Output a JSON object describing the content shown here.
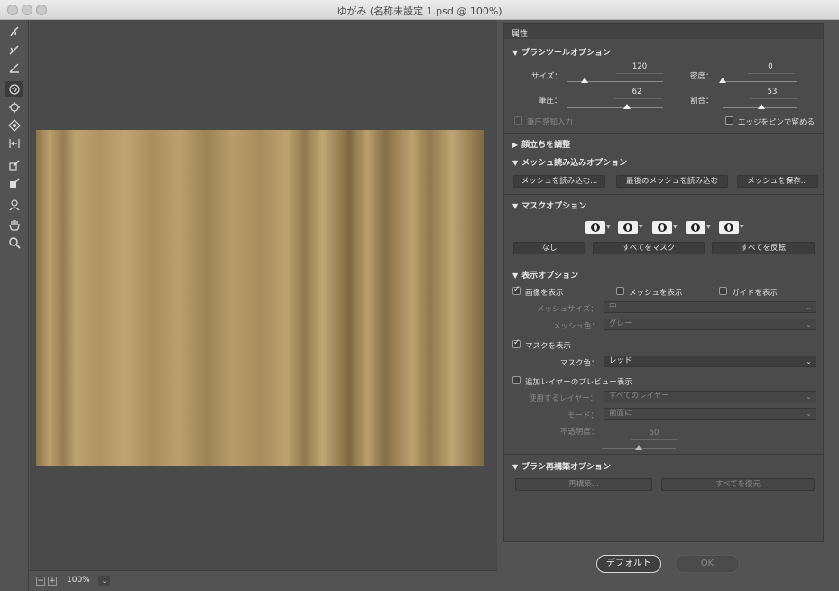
{
  "window": {
    "title": "ゆがみ (名称未設定 1.psd @ 100%)"
  },
  "toolbar": {
    "tools": [
      {
        "name": "forward-warp-tool",
        "active": false
      },
      {
        "name": "reconstruct-tool",
        "active": false
      },
      {
        "name": "smooth-tool",
        "active": false
      },
      {
        "name": "twirl-clockwise-tool",
        "active": true
      },
      {
        "name": "pucker-tool",
        "active": false
      },
      {
        "name": "bloat-tool",
        "active": false
      },
      {
        "name": "push-left-tool",
        "active": false
      },
      {
        "name": "freeze-mask-tool",
        "active": false
      },
      {
        "name": "thaw-mask-tool",
        "active": false
      },
      {
        "name": "face-tool",
        "active": false
      },
      {
        "name": "hand-tool",
        "active": false
      },
      {
        "name": "zoom-tool",
        "active": false
      }
    ]
  },
  "status": {
    "zoom": "100%",
    "zoom_out": "−",
    "zoom_in": "+",
    "dropdown": "⌄"
  },
  "panel": {
    "title": "属性",
    "brush_tool_options": {
      "title": "ブラシツールオプション",
      "size_label": "サイズ：",
      "size_value": "120",
      "size_level": 0.18,
      "density_label": "密度：",
      "density_value": "0",
      "density_level": 0.0,
      "pressure_label": "筆圧：",
      "pressure_value": "62",
      "pressure_level": 0.62,
      "rate_label": "割合：",
      "rate_value": "53",
      "rate_level": 0.53,
      "stylus_label": "筆圧感知入力",
      "pin_edges_label": "エッジをピンで留める"
    },
    "face_aware": {
      "title": "顔立ちを調整"
    },
    "mesh_load": {
      "title": "メッシュ読み込みオプション",
      "load_mesh": "メッシュを読み込む...",
      "load_last_mesh": "最後のメッシュを読み込む",
      "save_mesh": "メッシュを保存..."
    },
    "mask_options": {
      "title": "マスクオプション",
      "none": "なし",
      "mask_all": "すべてをマスク",
      "invert_all": "すべてを反転"
    },
    "view_options": {
      "title": "表示オプション",
      "show_image": "画像を表示",
      "show_mesh": "メッシュを表示",
      "show_guides": "ガイドを表示",
      "mesh_size_label": "メッシュサイズ：",
      "mesh_size_value": "中",
      "mesh_color_label": "メッシュ色：",
      "mesh_color_value": "グレー",
      "show_mask": "マスクを表示",
      "mask_color_label": "マスク色：",
      "mask_color_value": "レッド",
      "show_backdrop": "追加レイヤーのプレビュー表示",
      "use_layer_label": "使用するレイヤー：",
      "use_layer_value": "すべてのレイヤー",
      "mode_label": "モード：",
      "mode_value": "前面に",
      "opacity_label": "不透明度：",
      "opacity_value": "50",
      "opacity_level": 0.5
    },
    "brush_reconstruct": {
      "title": "ブラシ再構築オプション",
      "reconstruct": "再構築...",
      "restore_all": "すべてを復元"
    }
  },
  "footer": {
    "default": "デフォルト",
    "ok": "OK"
  },
  "arrows": {
    "down": "▼",
    "right": "▶",
    "chevron": "⌄"
  }
}
